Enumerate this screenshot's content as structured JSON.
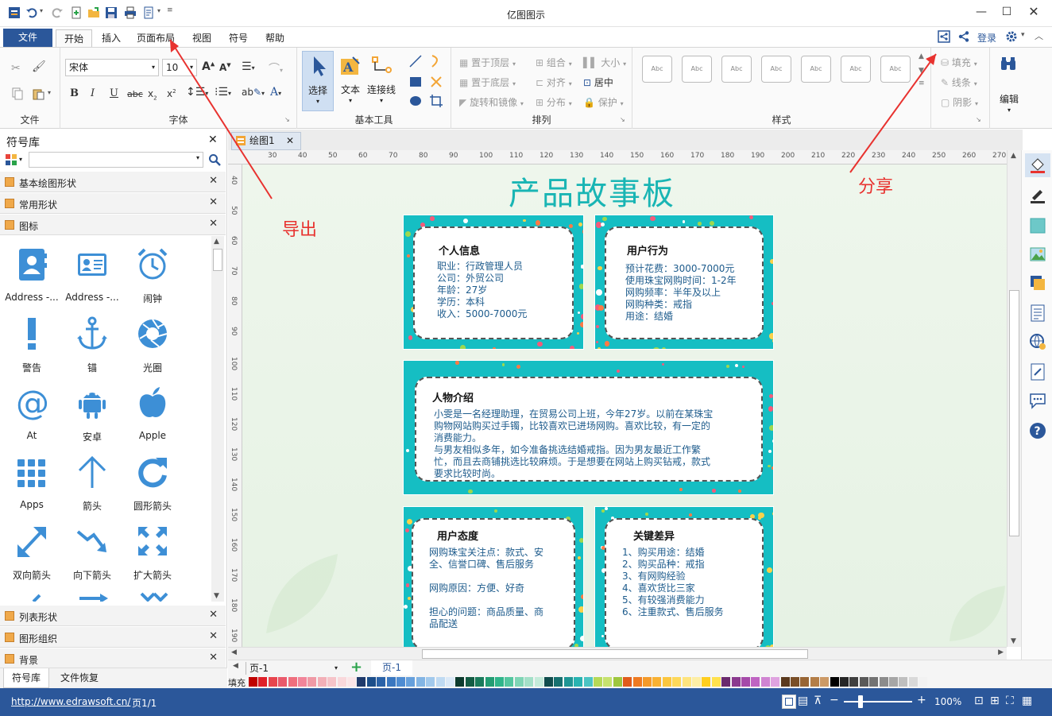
{
  "app": {
    "title": "亿图图示"
  },
  "menu": {
    "file": "文件",
    "items": [
      "开始",
      "插入",
      "页面布局",
      "视图",
      "符号",
      "帮助"
    ],
    "login": "登录"
  },
  "ribbon": {
    "groups": {
      "file": "文件",
      "font": "字体",
      "basic_tools": "基本工具",
      "arrange": "排列",
      "style": "样式"
    },
    "font_name": "宋体",
    "font_size": "10",
    "tools": {
      "select": "选择",
      "text": "文本",
      "connector": "连接线"
    },
    "arrange": {
      "bring_front": "置于顶层",
      "send_back": "置于底层",
      "rotate": "旋转和镜像",
      "group": "组合",
      "align": "对齐",
      "distribute": "分布",
      "size": "大小",
      "center": "居中",
      "protect": "保护"
    },
    "style_sample": "Abc",
    "format": {
      "fill": "填充",
      "line": "线条",
      "shadow": "阴影"
    },
    "edit": "编辑"
  },
  "library": {
    "title": "符号库",
    "sections_top": [
      "基本绘图形状",
      "常用形状",
      "图标"
    ],
    "symbols": [
      "Address -...",
      "Address -...",
      "闹钟",
      "警告",
      "锚",
      "光圈",
      "At",
      "安卓",
      "Apple",
      "Apps",
      "箭头",
      "圆形箭头",
      "双向箭头",
      "向下箭头",
      "扩大箭头"
    ],
    "sections_bottom": [
      "列表形状",
      "图形组织",
      "背景"
    ],
    "tabs": [
      "符号库",
      "文件恢复"
    ]
  },
  "document": {
    "tab": "绘图1"
  },
  "ruler": {
    "h": [
      "30",
      "40",
      "50",
      "60",
      "70",
      "80",
      "90",
      "100",
      "110",
      "120",
      "130",
      "140",
      "150",
      "160",
      "170",
      "180",
      "190",
      "200",
      "210",
      "220",
      "230",
      "240",
      "250",
      "260",
      "270"
    ],
    "v": [
      "40",
      "50",
      "60",
      "70",
      "80",
      "90",
      "100",
      "110",
      "120",
      "130",
      "140",
      "150",
      "160",
      "170",
      "180",
      "190"
    ]
  },
  "canvas": {
    "title": "产品故事板",
    "cards": [
      {
        "title": "个人信息",
        "lines": [
          "职业：行政管理人员",
          "公司：外贸公司",
          "年龄：27岁",
          "学历：本科",
          "收入：5000-7000元"
        ]
      },
      {
        "title": "用户行为",
        "lines": [
          "预计花费：3000-7000元",
          "使用珠宝网购时间：1-2年",
          "网购频率：半年及以上",
          "网购种类：戒指",
          "用途：结婚"
        ]
      },
      {
        "title": "人物介绍",
        "lines": [
          "小雯是一名经理助理，在贸易公司上班，今年27岁。以前在某珠宝",
          "购物网站购买过手镯，比较喜欢已进场网购。喜欢比较，有一定的",
          "消费能力。",
          "与男友相似多年，如今准备挑选结婚戒指。因为男友最近工作繁",
          "忙，而且去商铺挑选比较麻烦。于是想要在网站上购买钻戒，款式",
          "要求比较时尚。"
        ]
      },
      {
        "title": "用户态度",
        "lines": [
          "网购珠宝关注点：款式、安",
          "全、信誉口碑、售后服务",
          "",
          "网购原因：方便、好奇",
          "",
          "担心的问题：商品质量、商",
          "品配送"
        ]
      },
      {
        "title": "关键差异",
        "lines": [
          "1、购买用途：结婚",
          "2、购买品种：戒指",
          "3、有网购经验",
          "4、喜欢货比三家",
          "5、有较强消费能力",
          "6、注重款式、售后服务"
        ]
      }
    ]
  },
  "annotations": {
    "export": "导出",
    "share": "分享"
  },
  "pagebar": {
    "page_select": "页-1",
    "page_tab": "页-1",
    "fill_label": "填充"
  },
  "status": {
    "url": "http://www.edrawsoft.cn/",
    "page": "页1/1",
    "zoom": "100%"
  },
  "palette": [
    "#c00000",
    "#e0202a",
    "#e8454e",
    "#ea5a6c",
    "#ef6f7e",
    "#f2859a",
    "#f09aa6",
    "#f3b0b8",
    "#f6c4c9",
    "#f9d8db",
    "#fbe5e7",
    "#1f3a6b",
    "#1c4e8a",
    "#2a62a8",
    "#3a77c0",
    "#4e8cd2",
    "#66a0dc",
    "#83b5e4",
    "#a2c9ec",
    "#bfdaf2",
    "#dbe9f7",
    "#0d3b2e",
    "#135c44",
    "#1a7b5b",
    "#239d73",
    "#2fb58a",
    "#54c69f",
    "#7fd5b5",
    "#a4e0c8",
    "#c5ebda",
    "#114d4d",
    "#17706f",
    "#1f9594",
    "#29b3b1",
    "#4cc4c3",
    "#b6d957",
    "#c6e26e",
    "#9ec63e",
    "#e05b1c",
    "#ee7a22",
    "#f49a2a",
    "#f8b133",
    "#fbc63f",
    "#fdd85a",
    "#fee47e",
    "#fdeea6",
    "#ffce1f",
    "#ffe14d",
    "#6a2a6e",
    "#8b3a8f",
    "#a54aa9",
    "#bf64c2",
    "#d084d2",
    "#dfa3e0",
    "#5b3a1e",
    "#7a4f28",
    "#986535",
    "#b47e48",
    "#cc9a66",
    "#000000",
    "#262626",
    "#404040",
    "#595959",
    "#737373",
    "#8c8c8c",
    "#a6a6a6",
    "#bfbfbf",
    "#d9d9d9",
    "#f2f2f2"
  ]
}
